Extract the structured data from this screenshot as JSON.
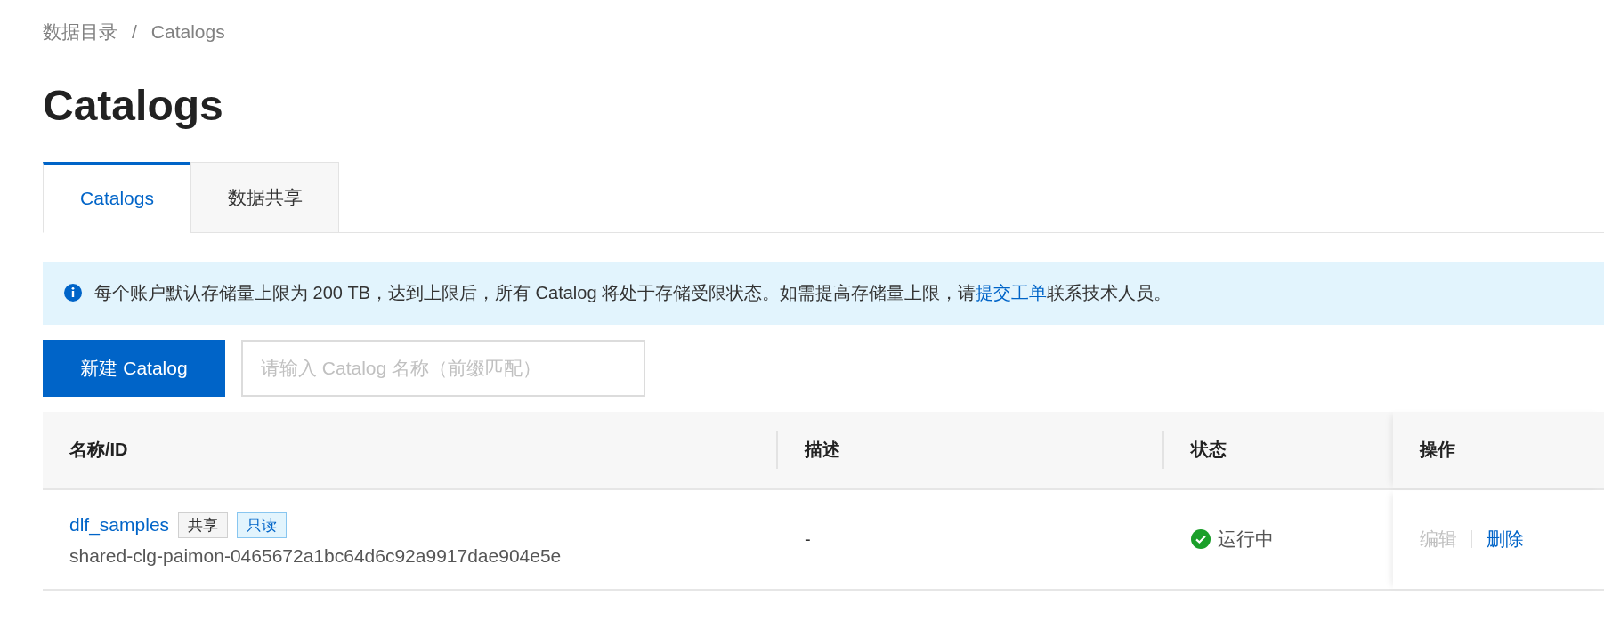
{
  "breadcrumb": [
    {
      "label": "数据目录"
    },
    {
      "label": "Catalogs"
    }
  ],
  "breadcrumb_separator": "/",
  "title": "Catalogs",
  "tabs": [
    {
      "label": "Catalogs",
      "selected": true
    },
    {
      "label": "数据共享",
      "selected": false
    }
  ],
  "alert": {
    "kind": "info",
    "text_before": "每个账户默认存储量上限为 200 TB，达到上限后，所有 Catalog 将处于存储受限状态。如需提高存储量上限，请",
    "link": "提交工单",
    "text_after": "联系技术人员。"
  },
  "create_button": "新建 Catalog",
  "search": {
    "placeholder": "请输入 Catalog 名称（前缀匹配）"
  },
  "table": {
    "columns": [
      "名称/ID",
      "描述",
      "状态",
      "操作"
    ],
    "rows": [
      {
        "name": "dlf_samples",
        "tags": [
          {
            "label": "共享",
            "kind": "neutral"
          },
          {
            "label": "只读",
            "kind": "info"
          }
        ],
        "id": "shared-clg-paimon-0465672a1bc64d6c92a9917dae904e5e",
        "description": "-",
        "status": {
          "kind": "running",
          "label": "运行中"
        },
        "actions": [
          {
            "label": "编辑",
            "disabled": true
          },
          {
            "label": "删除",
            "disabled": false
          }
        ]
      }
    ]
  }
}
